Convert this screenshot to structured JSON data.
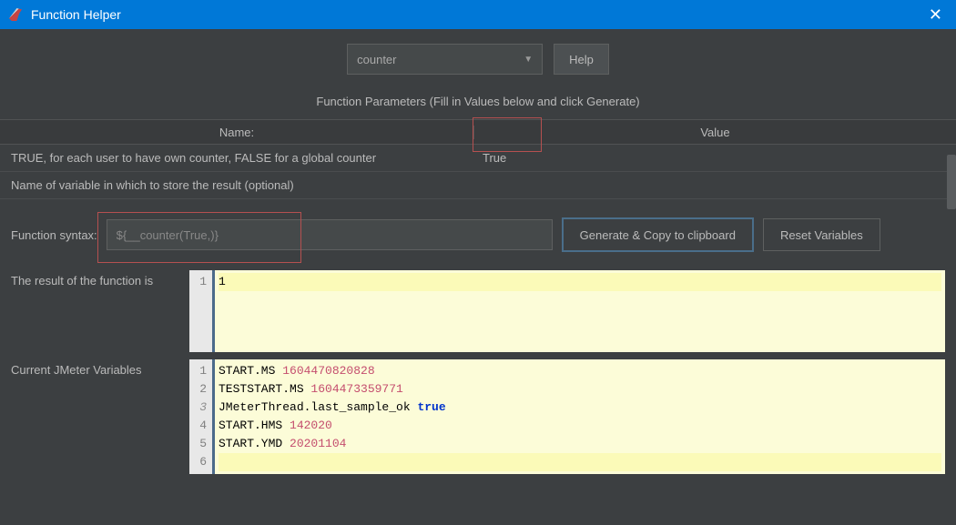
{
  "window": {
    "title": "Function Helper"
  },
  "selector": {
    "selected": "counter"
  },
  "buttons": {
    "help": "Help",
    "generate": "Generate & Copy to clipboard",
    "reset": "Reset Variables"
  },
  "labels": {
    "params_heading": "Function Parameters (Fill in Values below and click Generate)",
    "col_name": "Name:",
    "col_value": "Value",
    "syntax": "Function syntax:",
    "result": "The result of the function is",
    "vars": "Current JMeter Variables"
  },
  "params": [
    {
      "name": "TRUE, for each user to have own counter, FALSE for a global counter",
      "value": "True"
    },
    {
      "name": "Name of variable in which to store the result (optional)",
      "value": ""
    }
  ],
  "syntax_value": "${__counter(True,)}",
  "result_lines": [
    "1"
  ],
  "var_lines": [
    {
      "key": "START.MS",
      "val": "1604470820828"
    },
    {
      "key": "TESTSTART.MS",
      "val": "1604473359771"
    },
    {
      "key": "JMeterThread.last_sample_ok",
      "bool": "true"
    },
    {
      "key": "START.HMS",
      "val": "142020"
    },
    {
      "key": "START.YMD",
      "val": "20201104"
    }
  ]
}
